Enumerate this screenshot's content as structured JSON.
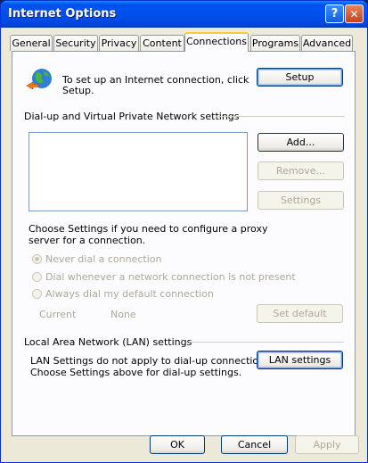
{
  "window": {
    "title": "Internet Options",
    "help_glyph": "?",
    "close_glyph": "✕"
  },
  "tabs": [
    {
      "label": "General"
    },
    {
      "label": "Security"
    },
    {
      "label": "Privacy"
    },
    {
      "label": "Content"
    },
    {
      "label": "Connections",
      "active": true
    },
    {
      "label": "Programs"
    },
    {
      "label": "Advanced"
    }
  ],
  "setup": {
    "text_line1": "To set up an Internet connection, click",
    "text_line2": "Setup.",
    "button": "Setup"
  },
  "dialup": {
    "heading": "Dial-up and Virtual Private Network settings",
    "add": "Add...",
    "remove": "Remove...",
    "settings": "Settings",
    "proxy_line1": "Choose Settings if you need to configure a proxy",
    "proxy_line2": "server for a connection.",
    "options": [
      {
        "label": "Never dial a connection",
        "checked": true
      },
      {
        "label": "Dial whenever a network connection is not present",
        "checked": false
      },
      {
        "label": "Always dial my default connection",
        "checked": false
      }
    ],
    "current_label": "Current",
    "current_value": "None",
    "set_default": "Set default"
  },
  "lan": {
    "heading": "Local Area Network (LAN) settings",
    "text_line1": "LAN Settings do not apply to dial-up connections.",
    "text_line2": "Choose Settings above for dial-up settings.",
    "button": "LAN settings"
  },
  "footer": {
    "ok": "OK",
    "cancel": "Cancel",
    "apply": "Apply"
  }
}
